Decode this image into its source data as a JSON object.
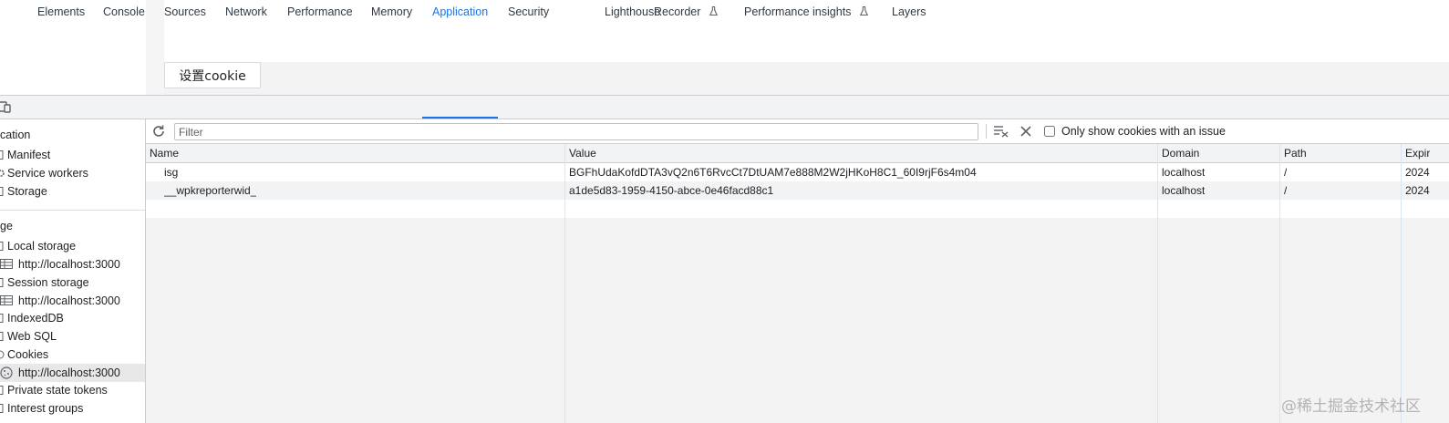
{
  "page": {
    "set_cookie_button": "设置cookie"
  },
  "devtools": {
    "tabs": [
      {
        "label": "Elements"
      },
      {
        "label": "Console"
      },
      {
        "label": "Sources"
      },
      {
        "label": "Network"
      },
      {
        "label": "Performance"
      },
      {
        "label": "Memory"
      },
      {
        "label": "Application",
        "active": true
      },
      {
        "label": "Security"
      },
      {
        "label": "Lighthouse"
      },
      {
        "label": "Recorder",
        "experimental": true
      },
      {
        "label": "Performance insights",
        "experimental": true
      },
      {
        "label": "Layers"
      }
    ],
    "accent": "#1a73e8"
  },
  "sidebar": {
    "section_application": "cation",
    "manifest": "Manifest",
    "service_workers": "Service workers",
    "storage": "Storage",
    "section_storage": "ge",
    "local_storage": "Local storage",
    "local_storage_origin": "http://localhost:3000",
    "session_storage": "Session storage",
    "session_storage_origin": "http://localhost:3000",
    "indexeddb": "IndexedDB",
    "web_sql": "Web SQL",
    "cookies": "Cookies",
    "cookies_origin": "http://localhost:3000",
    "private_state_tokens": "Private state tokens",
    "interest_groups": "Interest groups"
  },
  "toolbar": {
    "filter_placeholder": "Filter",
    "only_issue_label": "Only show cookies with an issue",
    "only_issue_checked": false
  },
  "cookies_table": {
    "columns": [
      "Name",
      "Value",
      "Domain",
      "Path",
      "Expir"
    ],
    "rows": [
      {
        "name": "isg",
        "value": "BGFhUdaKofdDTA3vQ2n6T6RvcCt7DtUAM7e888M2W2jHKoH8C1_60I9rjF6s4m04",
        "domain": "localhost",
        "path": "/",
        "expires": "2024"
      },
      {
        "name": "__wpkreporterwid_",
        "value": "a1de5d83-1959-4150-abce-0e46facd88c1",
        "domain": "localhost",
        "path": "/",
        "expires": "2024"
      }
    ]
  },
  "watermark": "@稀土掘金技术社区"
}
